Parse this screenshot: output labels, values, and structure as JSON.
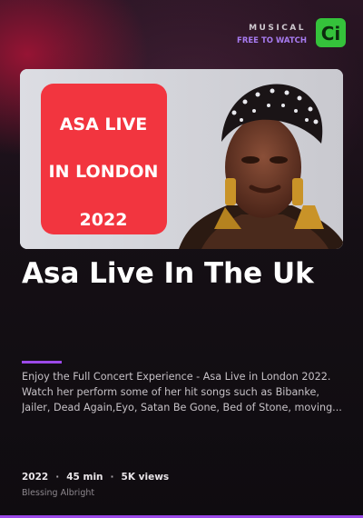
{
  "header": {
    "category": "MUSICAL",
    "availability": "FREE TO WATCH",
    "logo_text": "Ci",
    "logo_color": "#35c23b",
    "accent_color": "#a77bf0"
  },
  "thumbnail": {
    "poster_lines": [
      "ASA LIVE",
      "IN LONDON",
      "2022"
    ],
    "poster_color": "#f2353f"
  },
  "video": {
    "title": "Asa Live In The Uk",
    "description": "Enjoy the Full Concert Experience - Asa Live in London 2022. Watch her perform some of her hit songs such as Bibanke, Jailer, Dead Again,Eyo, Satan Be Gone, Bed of Stone, moving...",
    "year": "2022",
    "duration": "45 min",
    "views": "5K views",
    "separator": "·",
    "author": "Blessing Albright"
  }
}
